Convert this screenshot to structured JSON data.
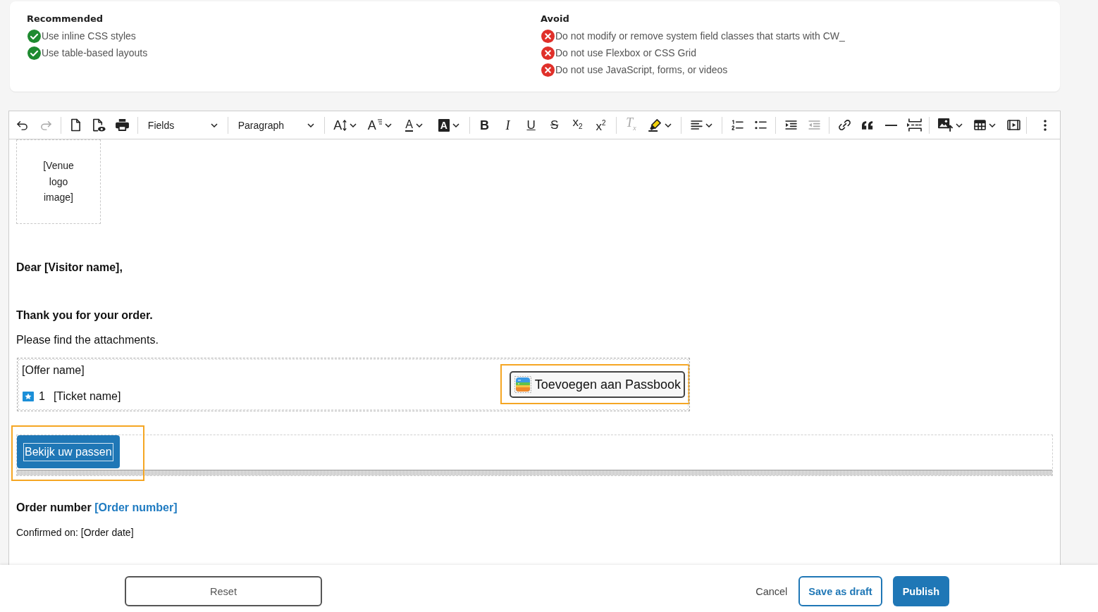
{
  "guidelines": [
    {
      "kind": "recommended",
      "heading": "Recommended",
      "items": [
        "Use inline CSS styles",
        "Use table-based layouts"
      ]
    },
    {
      "kind": "avoid",
      "heading": "Avoid",
      "items": [
        "Do not modify or remove system field classes that starts with CW_",
        "Do not use Flexbox or CSS Grid",
        "Do not use JavaScript, forms, or videos"
      ]
    }
  ],
  "editor": {
    "toolbar": [
      {
        "kind": "icon",
        "disabled": false,
        "menu": false
      },
      {
        "kind": "icon",
        "disabled": true,
        "menu": false
      },
      {
        "kind": "divider"
      },
      {
        "kind": "icon",
        "disabled": false,
        "menu": false
      },
      {
        "kind": "icon",
        "disabled": false,
        "menu": false
      },
      {
        "kind": "icon",
        "disabled": false,
        "menu": false
      },
      {
        "kind": "divider"
      },
      {
        "kind": "select",
        "label": "Fields"
      },
      {
        "kind": "divider"
      },
      {
        "kind": "select",
        "label": "Paragraph"
      },
      {
        "kind": "divider"
      },
      {
        "kind": "glyph",
        "text": "A",
        "disabled": false,
        "menu": true
      },
      {
        "kind": "glyph",
        "text": "A",
        "disabled": false,
        "menu": true
      },
      {
        "kind": "glyph",
        "text": "A",
        "disabled": false,
        "menu": true
      },
      {
        "kind": "glyph",
        "text": "A",
        "disabled": false,
        "menu": true
      },
      {
        "kind": "divider"
      },
      {
        "kind": "glyph",
        "text": "B",
        "disabled": false,
        "menu": false
      },
      {
        "kind": "glyph",
        "text": "I",
        "disabled": false,
        "menu": false
      },
      {
        "kind": "glyph",
        "text": "U",
        "disabled": false,
        "menu": false
      },
      {
        "kind": "glyph",
        "text": "S",
        "disabled": false,
        "menu": false
      },
      {
        "kind": "glyph",
        "text": "x$_{2}$",
        "disabled": false,
        "menu": false
      },
      {
        "kind": "glyph",
        "text": "x$^{2}$",
        "disabled": false,
        "menu": false
      },
      {
        "kind": "divider"
      },
      {
        "kind": "glyph",
        "text": "T$_{x}$",
        "disabled": true,
        "menu": false
      },
      {
        "kind": "icon",
        "disabled": false,
        "menu": true
      },
      {
        "kind": "divider"
      },
      {
        "kind": "icon",
        "disabled": false,
        "menu": true
      },
      {
        "kind": "divider"
      },
      {
        "kind": "icon",
        "disabled": false,
        "menu": false
      },
      {
        "kind": "icon",
        "disabled": false,
        "menu": false
      },
      {
        "kind": "divider"
      },
      {
        "kind": "icon",
        "disabled": false,
        "menu": false
      },
      {
        "kind": "icon",
        "disabled": true,
        "menu": false
      },
      {
        "kind": "divider"
      },
      {
        "kind": "icon",
        "disabled": false,
        "menu": false
      },
      {
        "kind": "icon",
        "disabled": false,
        "menu": false
      },
      {
        "kind": "icon",
        "disabled": false,
        "menu": false
      },
      {
        "kind": "icon",
        "disabled": false,
        "menu": false
      },
      {
        "kind": "divider"
      },
      {
        "kind": "icon",
        "disabled": false,
        "menu": true
      },
      {
        "kind": "icon",
        "disabled": false,
        "menu": true
      },
      {
        "kind": "icon",
        "disabled": false,
        "menu": false
      },
      {
        "kind": "divider"
      },
      {
        "kind": "icon",
        "disabled": false,
        "menu": false
      }
    ],
    "content": {
      "logo_placeholder": "[Venue logo image]",
      "greeting": "Dear [Visitor name],",
      "thanks": "Thank you for your order.",
      "intro": "Please find the attachments.",
      "ticket_table": {
        "offer_name": "[Offer name]",
        "tickets": [
          {
            "quantity": "1",
            "name": "[Ticket name]"
          }
        ],
        "passbook_button": {
          "label": "Toevoegen aan Passbook",
          "selected": true
        }
      },
      "passes_button": {
        "label": "Bekijk uw passen",
        "selected": true
      },
      "order_number": {
        "label": "Order number",
        "value": "[Order number]"
      },
      "confirmed": "Confirmed on: [Order date]"
    }
  },
  "footer": {
    "buttons": [
      {
        "kind": "outline",
        "label": "Reset"
      },
      {
        "kind": "link",
        "label": "Cancel"
      },
      {
        "kind": "secondary",
        "label": "Save as draft"
      },
      {
        "kind": "primary",
        "label": "Publish"
      }
    ]
  }
}
